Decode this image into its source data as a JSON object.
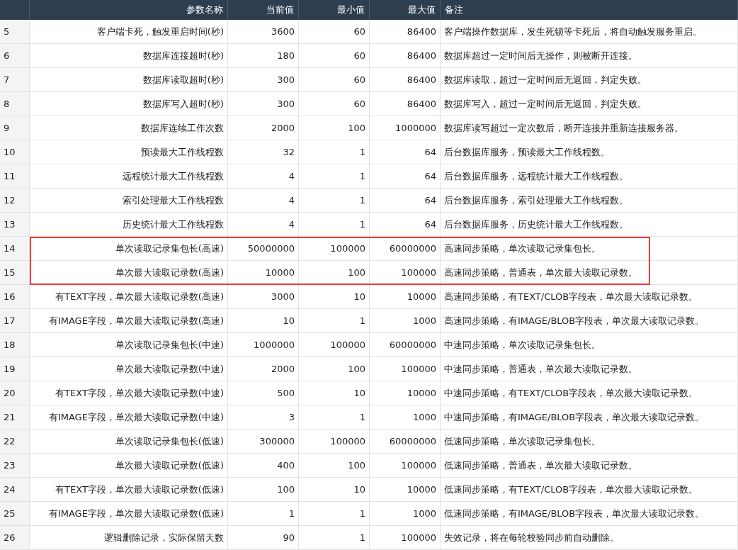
{
  "table": {
    "columns": [
      "",
      "参数名称",
      "当前值",
      "最小值",
      "最大值",
      "备注"
    ],
    "rows": [
      {
        "index": "5",
        "name": "客户端卡死，触发重启时间(秒)",
        "current": "3600",
        "min": "60",
        "max": "86400",
        "remark": "客户端操作数据库，发生死锁等卡死后，将自动触发服务重启。",
        "highlighted": false
      },
      {
        "index": "6",
        "name": "数据库连接超时(秒)",
        "current": "180",
        "min": "60",
        "max": "86400",
        "remark": "数据库超过一定时间后无操作，则被断开连接。",
        "highlighted": false
      },
      {
        "index": "7",
        "name": "数据库读取超时(秒)",
        "current": "300",
        "min": "60",
        "max": "86400",
        "remark": "数据库读取，超过一定时间后无返回，判定失败。",
        "highlighted": false
      },
      {
        "index": "8",
        "name": "数据库写入超时(秒)",
        "current": "300",
        "min": "60",
        "max": "86400",
        "remark": "数据库写入，超过一定时间后无返回，判定失败。",
        "highlighted": false
      },
      {
        "index": "9",
        "name": "数据库连续工作次数",
        "current": "2000",
        "min": "100",
        "max": "1000000",
        "remark": "数据库读写超过一定次数后，断开连接并重新连接服务器。",
        "highlighted": false
      },
      {
        "index": "10",
        "name": "预读最大工作线程数",
        "current": "32",
        "min": "1",
        "max": "64",
        "remark": "后台数据库服务，预读最大工作线程数。",
        "highlighted": false
      },
      {
        "index": "11",
        "name": "远程统计最大工作线程数",
        "current": "4",
        "min": "1",
        "max": "64",
        "remark": "后台数据库服务，远程统计最大工作线程数。",
        "highlighted": false
      },
      {
        "index": "12",
        "name": "索引处理最大工作线程数",
        "current": "4",
        "min": "1",
        "max": "64",
        "remark": "后台数据库服务，索引处理最大工作线程数。",
        "highlighted": false
      },
      {
        "index": "13",
        "name": "历史统计最大工作线程数",
        "current": "4",
        "min": "1",
        "max": "64",
        "remark": "后台数据库服务，历史统计最大工作线程数。",
        "highlighted": false
      },
      {
        "index": "14",
        "name": "单次读取记录集包长(高速)",
        "current": "50000000",
        "min": "100000",
        "max": "60000000",
        "remark": "高速同步策略，单次读取记录集包长。",
        "highlighted": true
      },
      {
        "index": "15",
        "name": "单次最大读取记录数(高速)",
        "current": "10000",
        "min": "100",
        "max": "100000",
        "remark": "高速同步策略，普通表，单次最大读取记录数。",
        "highlighted": true
      },
      {
        "index": "16",
        "name": "有TEXT字段，单次最大读取记录数(高速)",
        "current": "3000",
        "min": "10",
        "max": "10000",
        "remark": "高速同步策略，有TEXT/CLOB字段表，单次最大读取记录数。",
        "highlighted": false
      },
      {
        "index": "17",
        "name": "有IMAGE字段，单次最大读取记录数(高速)",
        "current": "10",
        "min": "1",
        "max": "1000",
        "remark": "高速同步策略，有IMAGE/BLOB字段表，单次最大读取记录数。",
        "highlighted": false
      },
      {
        "index": "18",
        "name": "单次读取记录集包长(中速)",
        "current": "1000000",
        "min": "100000",
        "max": "60000000",
        "remark": "中速同步策略，单次读取记录集包长。",
        "highlighted": false
      },
      {
        "index": "19",
        "name": "单次最大读取记录数(中速)",
        "current": "2000",
        "min": "100",
        "max": "100000",
        "remark": "中速同步策略，普通表，单次最大读取记录数。",
        "highlighted": false
      },
      {
        "index": "20",
        "name": "有TEXT字段，单次最大读取记录数(中速)",
        "current": "500",
        "min": "10",
        "max": "10000",
        "remark": "中速同步策略，有TEXT/CLOB字段表，单次最大读取记录数。",
        "highlighted": false
      },
      {
        "index": "21",
        "name": "有IMAGE字段，单次最大读取记录数(中速)",
        "current": "3",
        "min": "1",
        "max": "1000",
        "remark": "中速同步策略，有IMAGE/BLOB字段表，单次最大读取记录数。",
        "highlighted": false
      },
      {
        "index": "22",
        "name": "单次读取记录集包长(低速)",
        "current": "300000",
        "min": "100000",
        "max": "60000000",
        "remark": "低速同步策略，单次读取记录集包长。",
        "highlighted": false
      },
      {
        "index": "23",
        "name": "单次最大读取记录数(低速)",
        "current": "400",
        "min": "100",
        "max": "100000",
        "remark": "低速同步策略，普通表，单次最大读取记录数。",
        "highlighted": false
      },
      {
        "index": "24",
        "name": "有TEXT字段，单次最大读取记录数(低速)",
        "current": "100",
        "min": "10",
        "max": "10000",
        "remark": "低速同步策略，有TEXT/CLOB字段表，单次最大读取记录数。",
        "highlighted": false
      },
      {
        "index": "25",
        "name": "有IMAGE字段，单次最大读取记录数(低速)",
        "current": "1",
        "min": "1",
        "max": "1000",
        "remark": "低速同步策略，有IMAGE/BLOB字段表，单次最大读取记录数。",
        "highlighted": false
      },
      {
        "index": "26",
        "name": "逻辑删除记录，实际保留天数",
        "current": "90",
        "min": "1",
        "max": "100000",
        "remark": "失效记录，将在每轮校验同步前自动删除。",
        "highlighted": false
      }
    ]
  }
}
